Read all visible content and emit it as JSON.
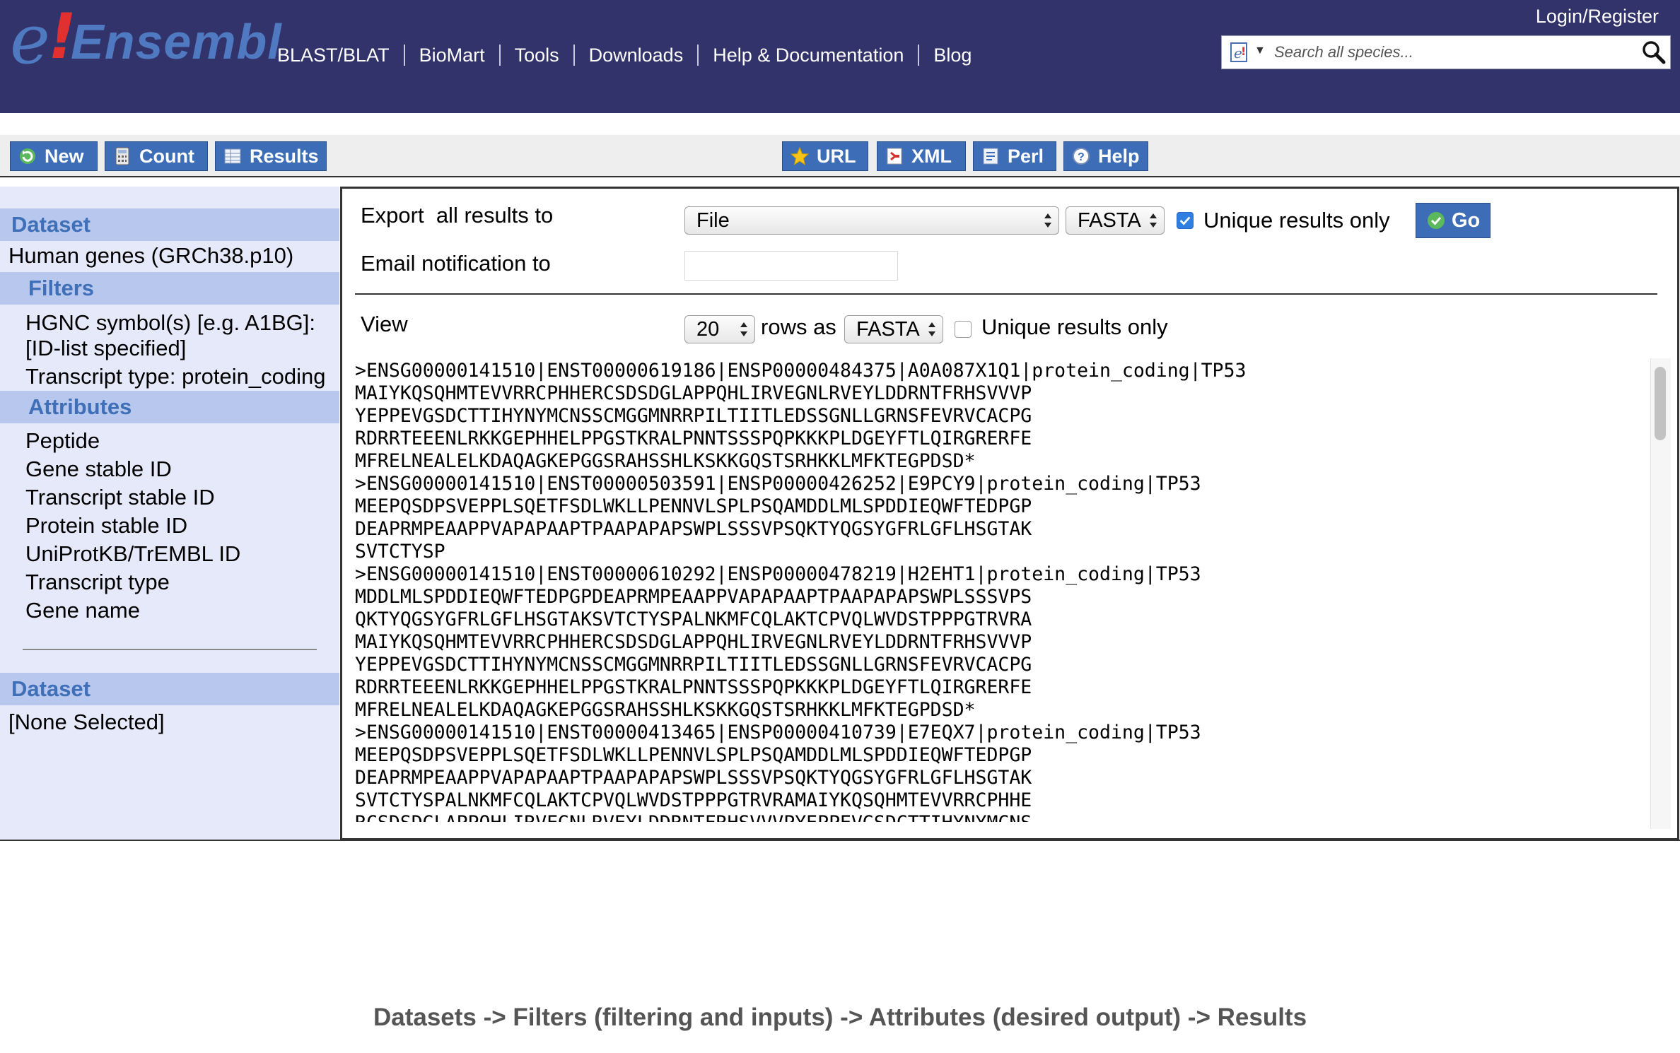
{
  "header": {
    "logo": {
      "e": "e",
      "bang": "!",
      "word": "Ensembl"
    },
    "nav": [
      "BLAST/BLAT",
      "BioMart",
      "Tools",
      "Downloads",
      "Help & Documentation",
      "Blog"
    ],
    "login": "Login/Register",
    "search_placeholder": "Search all species..."
  },
  "toolbar": {
    "new": "New",
    "count": "Count",
    "results": "Results",
    "url": "URL",
    "xml": "XML",
    "perl": "Perl",
    "help": "Help"
  },
  "sidebar": {
    "dataset_heading": "Dataset",
    "dataset_value": "Human genes (GRCh38.p10)",
    "filters_heading": "Filters",
    "filters": [
      "HGNC symbol(s) [e.g. A1BG]:",
      "[ID-list specified]",
      "Transcript type: protein_coding"
    ],
    "attributes_heading": "Attributes",
    "attributes": [
      "Peptide",
      "Gene stable ID",
      "Transcript stable ID",
      "Protein stable ID",
      "UniProtKB/TrEMBL ID",
      "Transcript type",
      "Gene name"
    ],
    "dataset2_heading": "Dataset",
    "dataset2_value": "[None Selected]"
  },
  "export": {
    "label": "Export  all results to",
    "destination": "File",
    "format": "FASTA",
    "unique_checked": true,
    "unique_label": "Unique results only",
    "go": "Go",
    "email_label": "Email notification to",
    "email_value": ""
  },
  "view": {
    "label": "View",
    "rows": "20",
    "rows_as": "rows as",
    "format": "FASTA",
    "unique_checked": false,
    "unique_label": "Unique results only"
  },
  "results_lines": [
    ">ENSG00000141510|ENST00000619186|ENSP00000484375|A0A087X1Q1|protein_coding|TP53",
    "MAIYKQSQHMTEVVRRCPHHERCSDSDGLAPPQHLIRVEGNLRVEYLDDRNTFRHSVVVP",
    "YEPPEVGSDCTTIHYNYMCNSSCMGGMNRRPILTIITLEDSSGNLLGRNSFEVRVCACPG",
    "RDRRTEEENLRKKGEPHHELPPGSTKRALPNNTSSSPQPKKKPLDGEYFTLQIRGRERFE",
    "MFRELNEALELKDAQAGKEPGGSRAHSSHLKSKKGQSTSRHKKLMFKTEGPDSD*",
    ">ENSG00000141510|ENST00000503591|ENSP00000426252|E9PCY9|protein_coding|TP53",
    "MEEPQSDPSVEPPLSQETFSDLWKLLPENNVLSPLPSQAMDDLMLSPDDIEQWFTEDPGP",
    "DEAPRMPEAAPPVAPAPAAPTPAAPAPAPSWPLSSSVPSQKTYQGSYGFRLGFLHSGTAK",
    "SVTCTYSP",
    ">ENSG00000141510|ENST00000610292|ENSP00000478219|H2EHT1|protein_coding|TP53",
    "MDDLMLSPDDIEQWFTEDPGPDEAPRMPEAAPPVAPAPAAPTPAAPAPAPSWPLSSSVPS",
    "QKTYQGSYGFRLGFLHSGTAKSVTCTYSPALNKMFCQLAKTCPVQLWVDSTPPPGTRVRA",
    "MAIYKQSQHMTEVVRRCPHHERCSDSDGLAPPQHLIRVEGNLRVEYLDDRNTFRHSVVVP",
    "YEPPEVGSDCTTIHYNYMCNSSCMGGMNRRPILTIITLEDSSGNLLGRNSFEVRVCACPG",
    "RDRRTEEENLRKKGEPHHELPPGSTKRALPNNTSSSPQPKKKPLDGEYFTLQIRGRERFE",
    "MFRELNEALELKDAQAGKEPGGSRAHSSHLKSKKGQSTSRHKKLMFKTEGPDSD*",
    ">ENSG00000141510|ENST00000413465|ENSP00000410739|E7EQX7|protein_coding|TP53",
    "MEEPQSDPSVEPPLSQETFSDLWKLLPENNVLSPLPSQAMDDLMLSPDDIEQWFTEDPGP",
    "DEAPRMPEAAPPVAPAPAAPTPAAPAPAPSWPLSSSVPSQKTYQGSYGFRLGFLHSGTAK",
    "SVTCTYSPALNKMFCQLAKTCPVQLWVDSTPPPGTRVRAMAIYKQSQHMTEVVRRCPHHE",
    "RCSDSDGLAPPQHLIRVEGNLRVEYLDDRNTFRHSVVVPYEPPEVGSDCTTIHYNYMCNS"
  ],
  "caption": "Datasets -> Filters (filtering and inputs) -> Attributes (desired output) -> Results",
  "colors": {
    "masthead": "#33336b",
    "button": "#3c6db6",
    "sidebar_bg": "#e6e9fa",
    "sidebar_head": "#b7c7ee",
    "heading_text": "#3f6fb6"
  }
}
